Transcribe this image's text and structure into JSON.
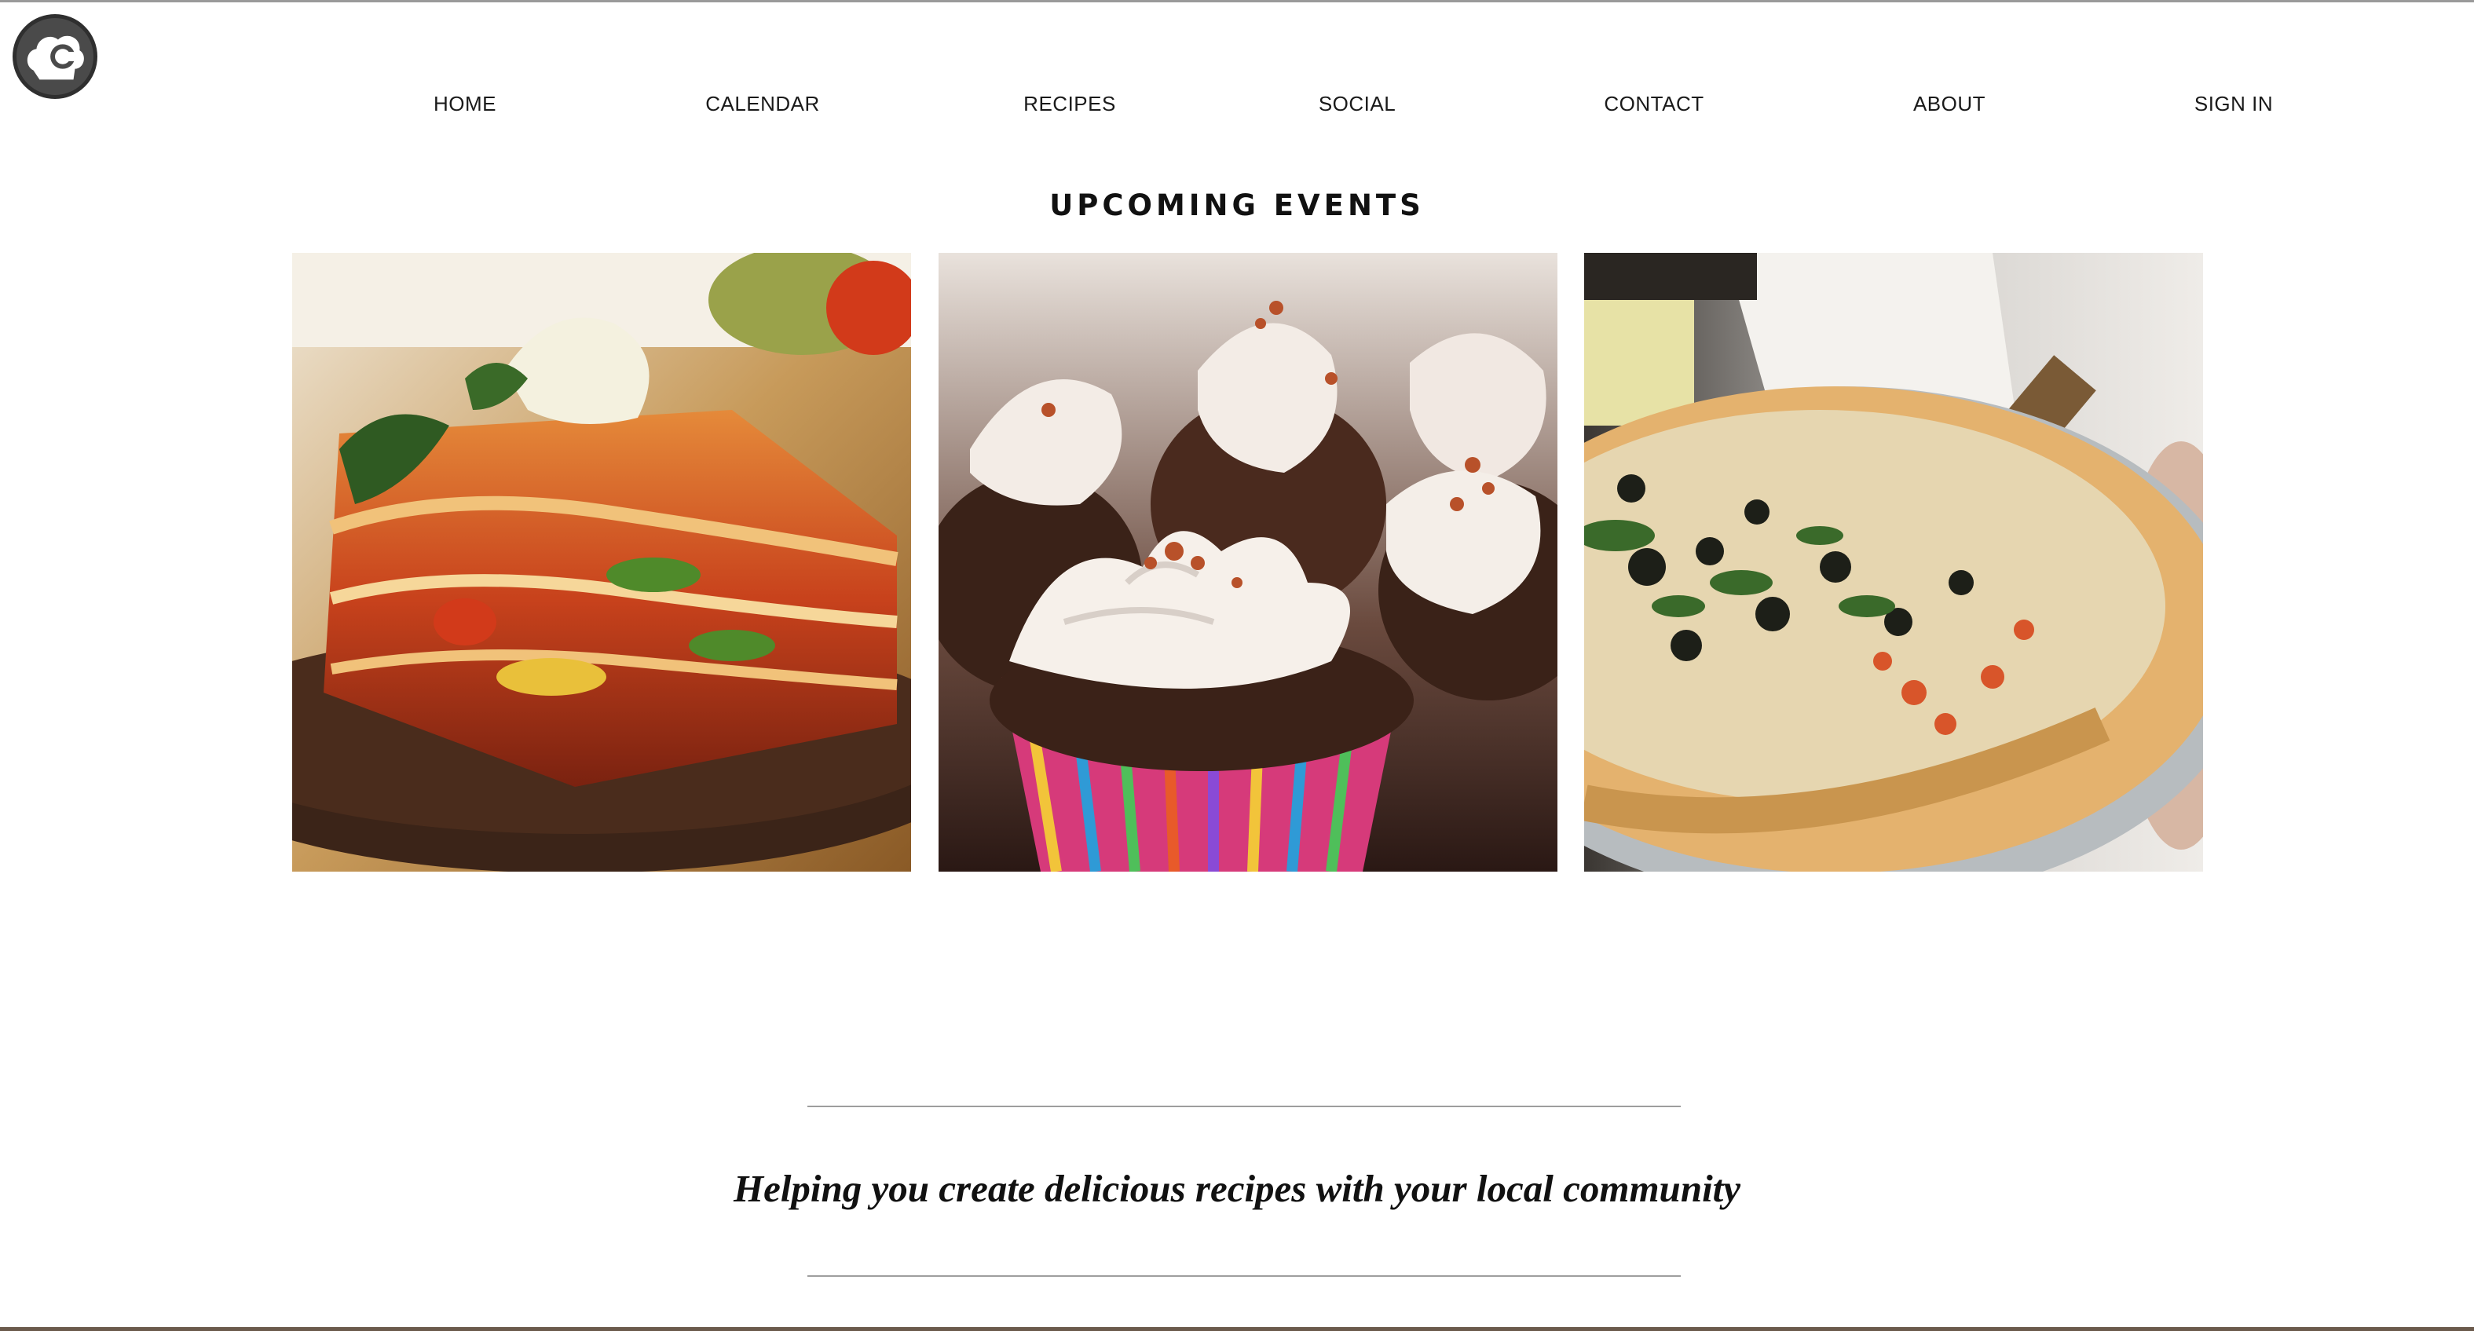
{
  "nav": {
    "items": [
      {
        "label": "HOME"
      },
      {
        "label": "CALENDAR"
      },
      {
        "label": "RECIPES"
      },
      {
        "label": "SOCIAL"
      },
      {
        "label": "CONTACT"
      },
      {
        "label": "ABOUT"
      },
      {
        "label": "SIGN IN"
      }
    ]
  },
  "events": {
    "title": "UPCOMING EVENTS",
    "cards": [
      {
        "image": "lasagna-photo"
      },
      {
        "image": "cupcakes-photo"
      },
      {
        "image": "pizza-photo"
      }
    ]
  },
  "tagline": "Helping you create delicious recipes with your local community",
  "colors": {
    "background": "#ffffff",
    "text": "#111111",
    "divider": "#9e9e9e",
    "logo": "#4a4a4a"
  }
}
